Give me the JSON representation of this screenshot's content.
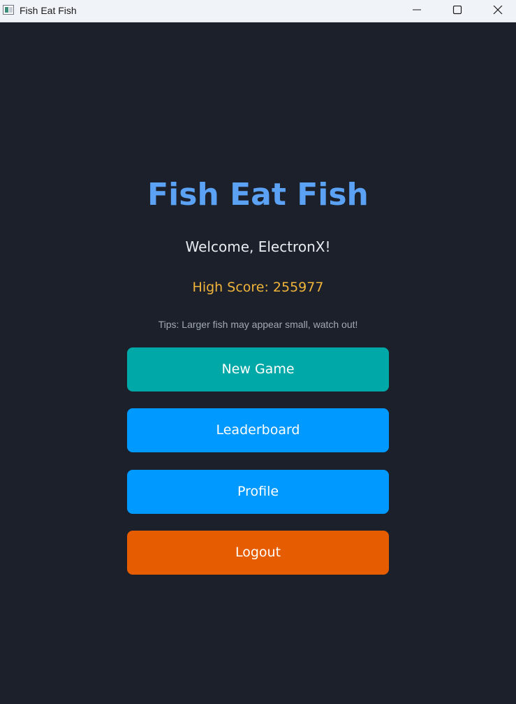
{
  "window": {
    "title": "Fish Eat Fish",
    "controls": [
      "minimize-icon",
      "maximize-icon",
      "close-icon"
    ]
  },
  "main": {
    "title": "Fish Eat Fish",
    "welcome": "Welcome, ElectronX!",
    "high_score": "High Score: 255977",
    "tips": "Tips: Larger fish may appear small, watch out!"
  },
  "menu": {
    "new_game": "New Game",
    "leaderboard": "Leaderboard",
    "profile": "Profile",
    "logout": "Logout"
  },
  "colors": {
    "background": "#1b202b",
    "title": "#5ba2f4",
    "high_score": "#f0b43a",
    "new_game": "#00a8a8",
    "primary": "#0099ff",
    "logout": "#e55d00"
  }
}
